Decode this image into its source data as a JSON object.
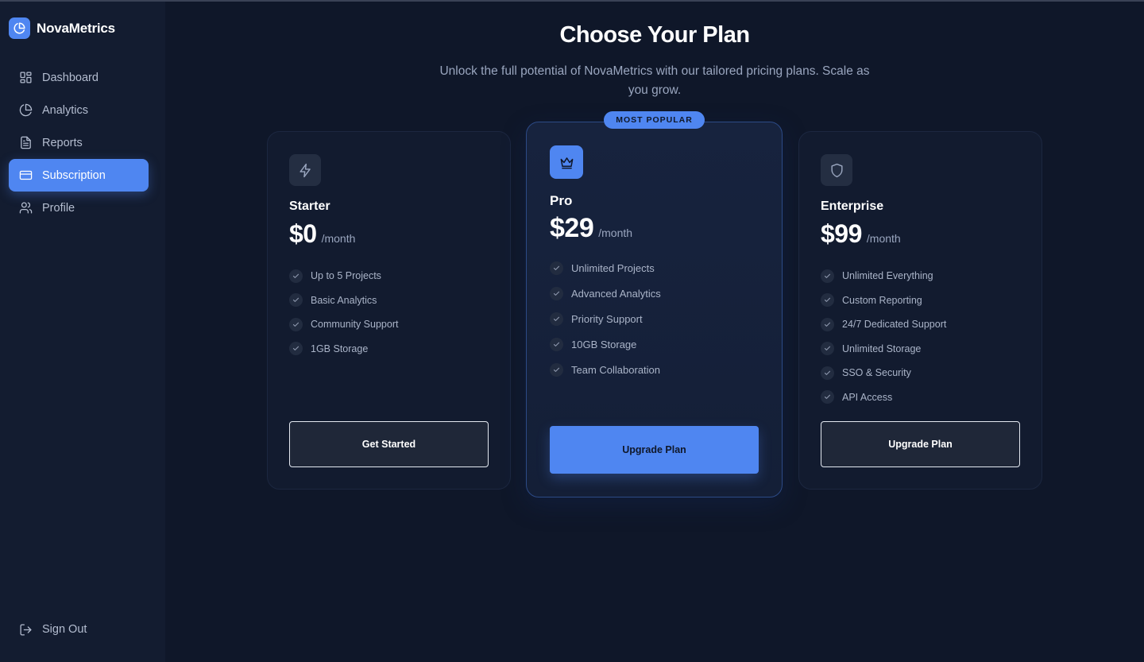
{
  "brand": {
    "name": "NovaMetrics",
    "icon": "pie-chart-icon"
  },
  "sidebar": {
    "items": [
      {
        "label": "Dashboard",
        "icon": "grid-icon",
        "active": false
      },
      {
        "label": "Analytics",
        "icon": "pie-chart-icon",
        "active": false
      },
      {
        "label": "Reports",
        "icon": "document-icon",
        "active": false
      },
      {
        "label": "Subscription",
        "icon": "credit-card-icon",
        "active": true
      },
      {
        "label": "Profile",
        "icon": "users-icon",
        "active": false
      }
    ],
    "signout": {
      "label": "Sign Out",
      "icon": "logout-icon"
    }
  },
  "page": {
    "title": "Choose Your Plan",
    "subtitle": "Unlock the full potential of NovaMetrics with our tailored pricing plans. Scale as you grow."
  },
  "plans": [
    {
      "name": "Starter",
      "icon": "lightning-icon",
      "price": "$0",
      "period": "/month",
      "features": [
        "Up to 5 Projects",
        "Basic Analytics",
        "Community Support",
        "1GB Storage"
      ],
      "button": "Get Started"
    },
    {
      "name": "Pro",
      "icon": "crown-icon",
      "price": "$29",
      "period": "/month",
      "badge": "MOST POPULAR",
      "features": [
        "Unlimited Projects",
        "Advanced Analytics",
        "Priority Support",
        "10GB Storage",
        "Team Collaboration"
      ],
      "button": "Upgrade Plan"
    },
    {
      "name": "Enterprise",
      "icon": "shield-icon",
      "price": "$99",
      "period": "/month",
      "features": [
        "Unlimited Everything",
        "Custom Reporting",
        "24/7 Dedicated Support",
        "Unlimited Storage",
        "SSO & Security",
        "API Access"
      ],
      "button": "Upgrade Plan"
    }
  ],
  "colors": {
    "accent": "#4f86f1",
    "background": "#0f1729",
    "sidebar": "#131c30"
  }
}
